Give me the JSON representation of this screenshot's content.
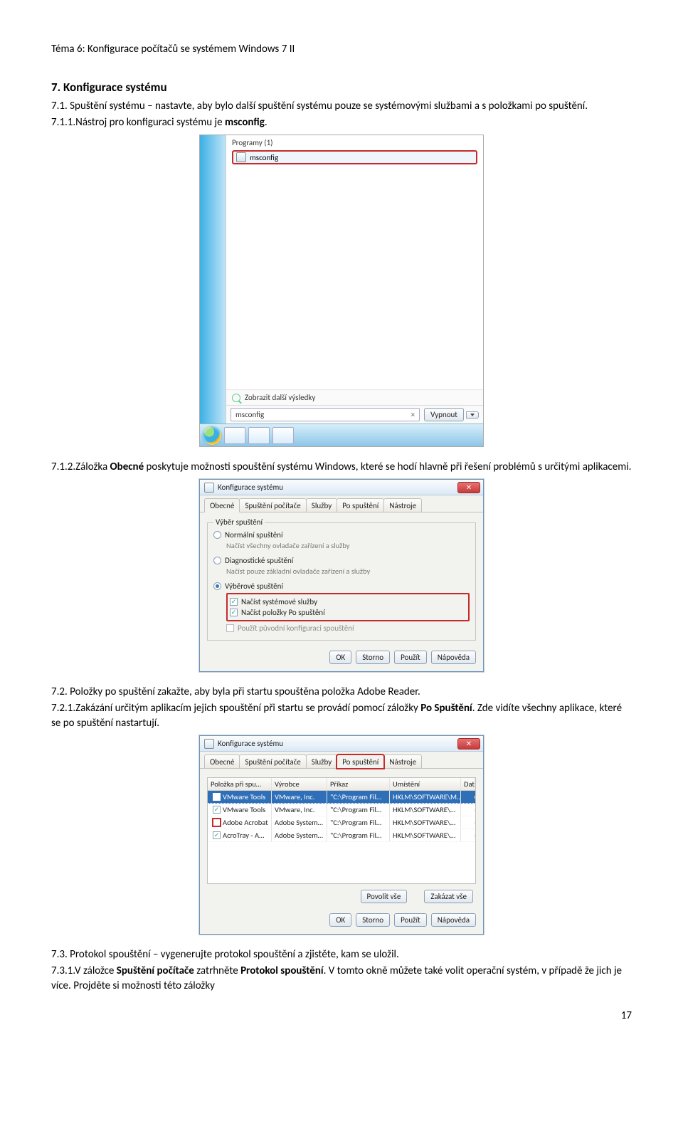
{
  "header": "Téma 6: Konfigurace počítačů se systémem Windows 7 II",
  "section7": {
    "title": "7.    Konfigurace systému",
    "p71": "7.1. Spuštění systému – nastavte, aby bylo další spuštění systému pouze se systémovými službami a s položkami po spuštění.",
    "p711_a": "7.1.1.Nástroj pro konfiguraci systému je ",
    "p711_b": "msconfig",
    "p711_c": ".",
    "p712_a": "7.1.2.Záložka ",
    "p712_b": "Obecné",
    "p712_c": " poskytuje možnosti spouštění systému Windows, které se hodí hlavně při řešení problémů s určitými aplikacemi.",
    "p72": "7.2.  Položky po spuštění zakažte, aby byla při startu spouštěna položka Adobe Reader.",
    "p721_a": "7.2.1.Zakázání určitým aplikacím jejich spouštění při startu se provádí pomocí záložky ",
    "p721_b": "Po Spuštění",
    "p721_c": ". Zde vidíte všechny aplikace, které se po spuštění nastartují.",
    "p73": "7.3.   Protokol spouštění – vygenerujte protokol spouštění a zjistěte, kam se uložil.",
    "p731_a": "7.3.1.V záložce ",
    "p731_b": "Spuštění počítače",
    "p731_c": " zatrhněte ",
    "p731_d": "Protokol spouštění",
    "p731_e": ". V tomto okně můžete také volit operační systém, v případě že jich je více. Projděte si možnosti této záložky"
  },
  "startmenu": {
    "programs_header": "Programy (1)",
    "hit_text": "msconfig",
    "more_results": "Zobrazit další výsledky",
    "search_value": "msconfig",
    "shutdown_label": "Vypnout"
  },
  "dlg_common": {
    "title": "Konfigurace systému",
    "tabs": [
      "Obecné",
      "Spuštění počítače",
      "Služby",
      "Po spuštění",
      "Nástroje"
    ],
    "ok": "OK",
    "cancel": "Storno",
    "apply": "Použít",
    "help": "Nápověda"
  },
  "dlg_obecne": {
    "group_legend": "Výběr spuštění",
    "r1": "Normální spuštění",
    "r1d": "Načíst všechny ovladače zařízení a služby",
    "r2": "Diagnostické spuštění",
    "r2d": "Načíst pouze základní ovladače zařízení a služby",
    "r3": "Výběrové spuštění",
    "c1": "Načíst systémové služby",
    "c2": "Načíst položky Po spuštění",
    "c3": "Použít původní konfiguraci spouštění"
  },
  "dlg_startup": {
    "cols": [
      "Položka při spu…",
      "Výrobce",
      "Příkaz",
      "Umístění",
      "Datum zakázání"
    ],
    "rows": [
      {
        "on": true,
        "sel": true,
        "c": [
          "VMware Tools",
          "VMware, Inc.",
          "\"C:\\Program Fil…",
          "HKLM\\SOFTWARE\\M…",
          ""
        ]
      },
      {
        "on": true,
        "c": [
          "VMware Tools",
          "VMware, Inc.",
          "\"C:\\Program Fil…",
          "HKLM\\SOFTWARE\\…",
          ""
        ]
      },
      {
        "on": false,
        "red": true,
        "c": [
          "Adobe Acrobat",
          "Adobe System…",
          "\"C:\\Program Fil…",
          "HKLM\\SOFTWARE\\…",
          ""
        ]
      },
      {
        "on": true,
        "c": [
          "AcroTray - A…",
          "Adobe System…",
          "\"C:\\Program Fil…",
          "HKLM\\SOFTWARE\\…",
          ""
        ]
      }
    ],
    "enable_all": "Povolit vše",
    "disable_all": "Zakázat vše"
  },
  "page_number": "17"
}
